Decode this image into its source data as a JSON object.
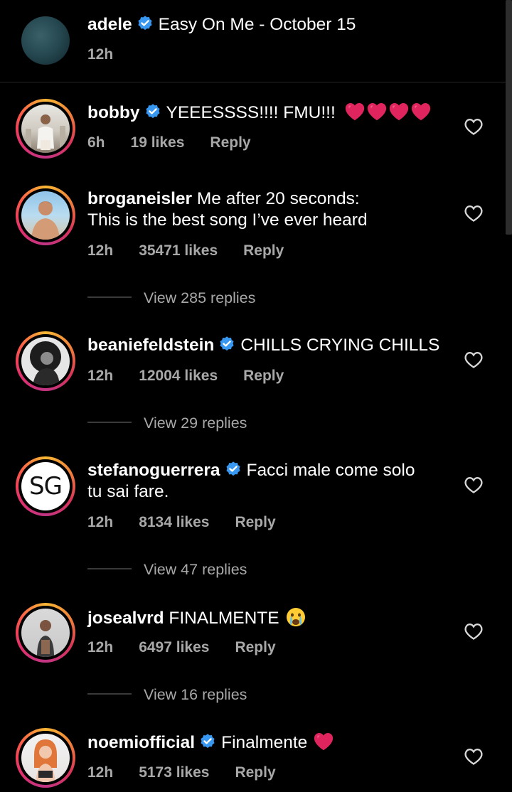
{
  "caption": {
    "username": "adele",
    "text": "Easy On Me - October 15",
    "time": "12h"
  },
  "comments": [
    {
      "username": "bobby",
      "verified": true,
      "line1": "YEEESSSS!!!! FMU!!!",
      "line2": "",
      "emoji": "red-hearts x4",
      "time": "6h",
      "likes": "19 likes",
      "reply": "Reply",
      "view_replies": ""
    },
    {
      "username": "broganeisler",
      "verified": false,
      "line1": "Me after 20 seconds:",
      "line2": "This is the best song I’ve ever heard",
      "time": "12h",
      "likes": "35471 likes",
      "reply": "Reply",
      "view_replies": "View 285 replies"
    },
    {
      "username": "beaniefeldstein",
      "verified": true,
      "line1": "CHILLS CRYING CHILLS",
      "line2": "",
      "time": "12h",
      "likes": "12004 likes",
      "reply": "Reply",
      "view_replies": "View 29 replies"
    },
    {
      "username": "stefanoguerrera",
      "verified": true,
      "line1": "Facci male come solo",
      "line2": "tu sai fare.",
      "avatar_text": "SG",
      "time": "12h",
      "likes": "8134 likes",
      "reply": "Reply",
      "view_replies": "View 47 replies"
    },
    {
      "username": "josealvrd",
      "verified": false,
      "line1": "FINALMENTE",
      "line2": "",
      "emoji": "crying-face",
      "time": "12h",
      "likes": "6497 likes",
      "reply": "Reply",
      "view_replies": "View 16 replies"
    },
    {
      "username": "noemiofficial",
      "verified": true,
      "line1": "Finalmente",
      "line2": "",
      "emoji": "red-heart",
      "time": "12h",
      "likes": "5173 likes",
      "reply": "Reply",
      "view_replies": ""
    }
  ],
  "colors": {
    "background": "#000000",
    "text": "#ffffff",
    "meta": "#a8a8a8",
    "verified": "#3897f0",
    "heart_emoji": "#e0245e"
  }
}
